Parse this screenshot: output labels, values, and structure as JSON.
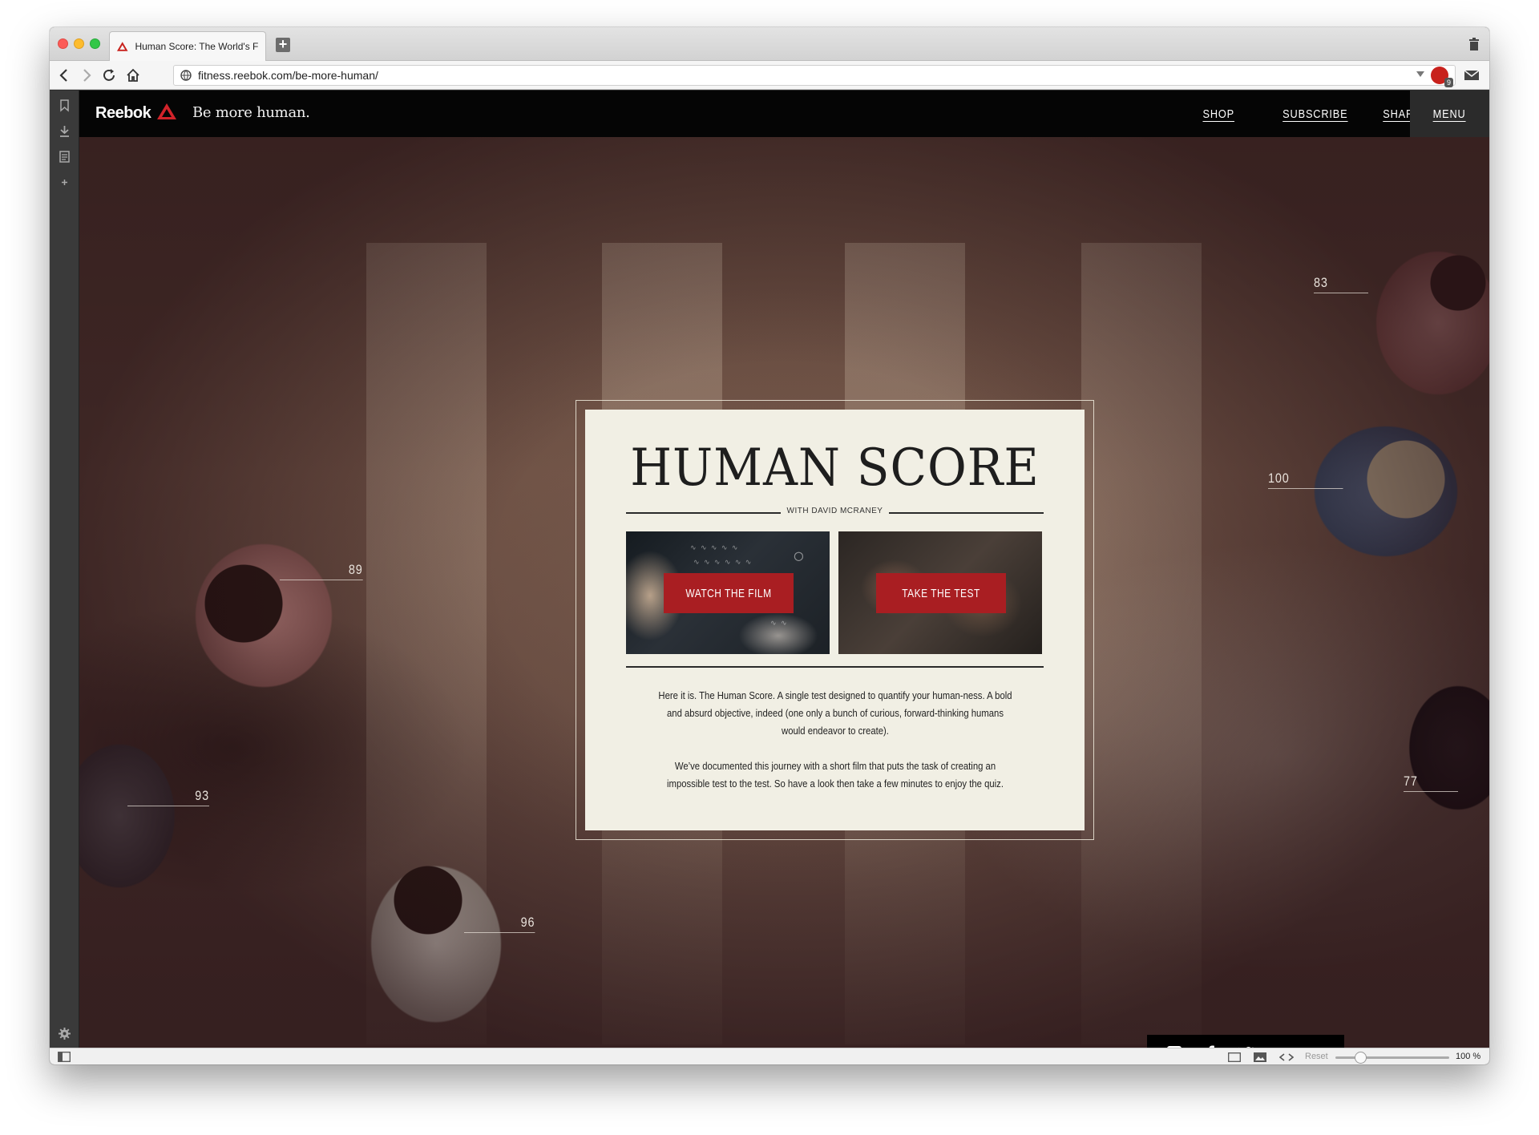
{
  "browser": {
    "tab_title": "Human Score: The World's Fi",
    "url": "fitness.reebok.com/be-more-human/",
    "extension_badge": "9",
    "status": {
      "reset_label": "Reset",
      "zoom_level": "100 %",
      "zoom_fraction": 0.17
    }
  },
  "site": {
    "logo": "Reebok",
    "tagline": "Be more human.",
    "nav": {
      "shop": "SHOP",
      "subscribe": "SUBSCRIBE",
      "share": "SHARE",
      "menu": "MENU"
    },
    "scores": {
      "s83": "83",
      "s100": "100",
      "s89": "89",
      "s93": "93",
      "s96": "96",
      "s77": "77"
    },
    "card": {
      "title": "HUMAN SCORE",
      "byline": "WITH DAVID MCRANEY",
      "film_button": "WATCH THE FILM",
      "test_button": "TAKE THE TEST",
      "paragraph1": "Here it is. The Human Score. A single test designed to quantify your human-ness. A bold and absurd objective, indeed (one only a bunch of curious, forward-thinking humans would endeavor to create).",
      "paragraph2": "We’ve documented this journey with a short film that puts the task of creating an impossible test to the test. So have a look then take a few minutes to enjoy the quiz."
    },
    "share_icons": [
      "linkedin-icon",
      "facebook-icon",
      "twitter-icon",
      "google-plus-icon",
      "email-icon"
    ]
  },
  "colors": {
    "brand_red": "#a91e22",
    "card_bg": "#f1efe4",
    "header_bg": "#050505"
  }
}
